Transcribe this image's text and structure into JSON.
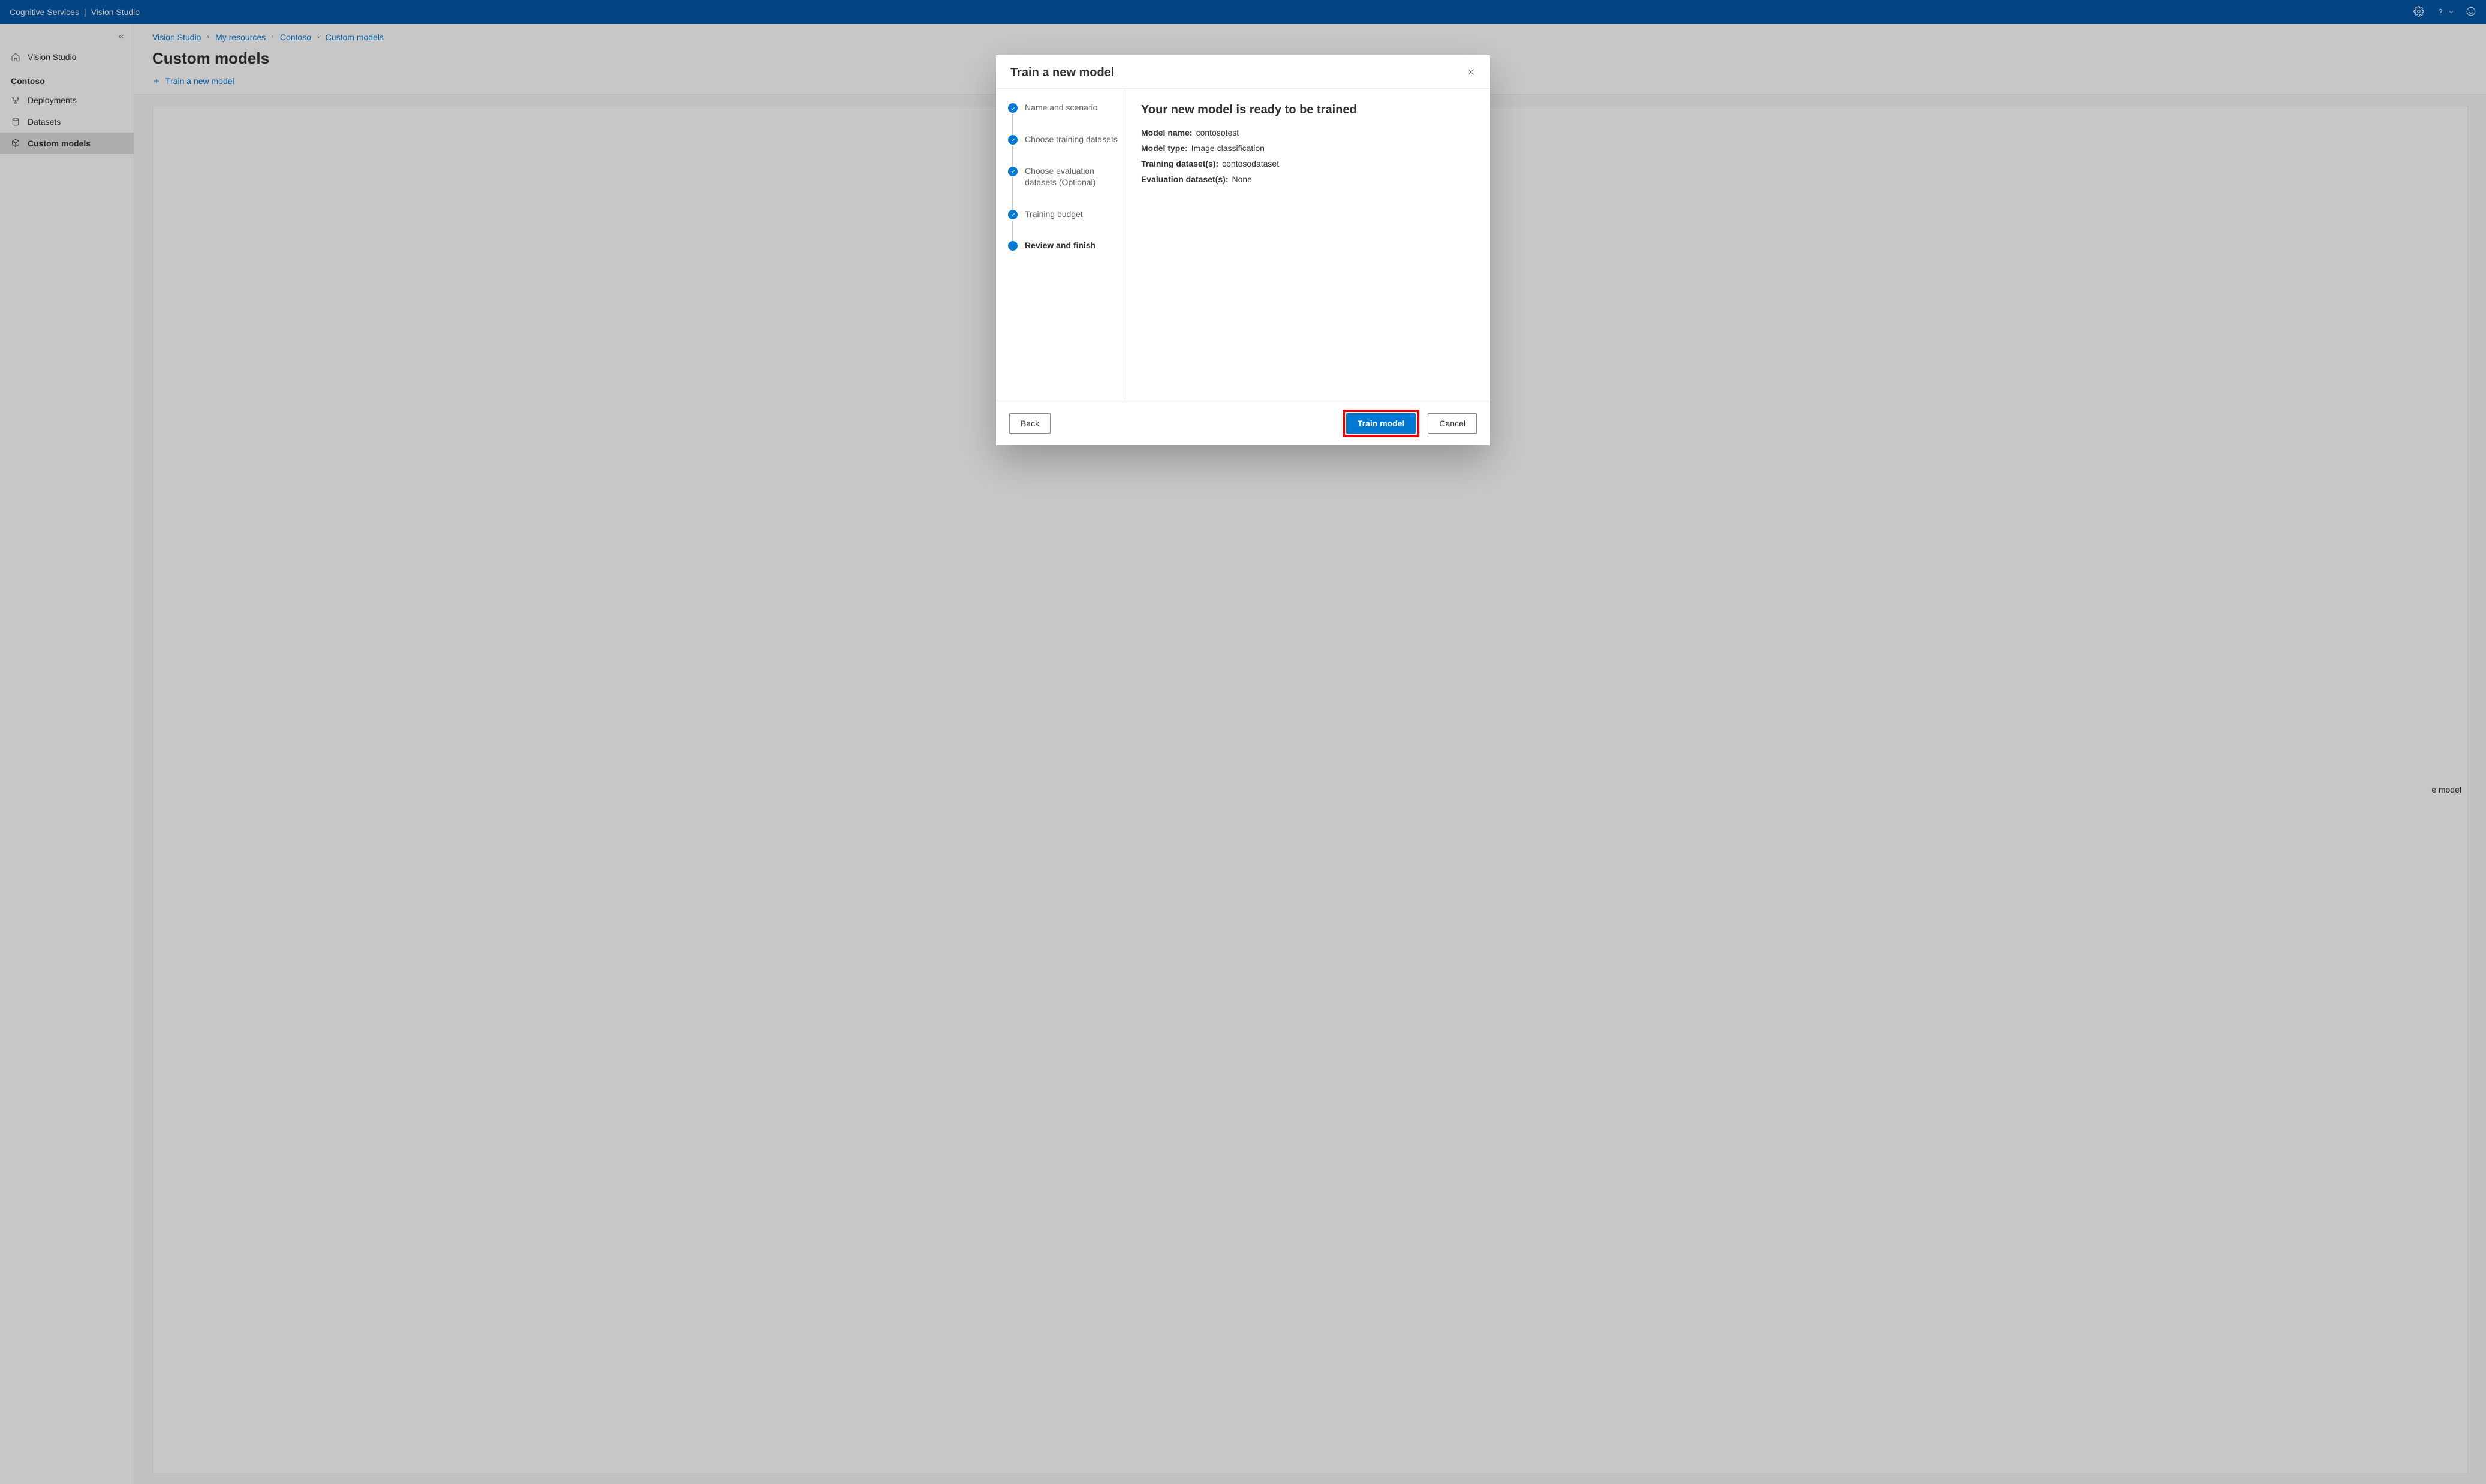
{
  "topbar": {
    "service": "Cognitive Services",
    "app": "Vision Studio"
  },
  "sidebar": {
    "home_label": "Vision Studio",
    "resource_label": "Contoso",
    "items": [
      {
        "label": "Deployments"
      },
      {
        "label": "Datasets"
      },
      {
        "label": "Custom models"
      }
    ]
  },
  "breadcrumbs": [
    "Vision Studio",
    "My resources",
    "Contoso",
    "Custom models"
  ],
  "page": {
    "title": "Custom models",
    "train_action": "Train a new model",
    "hint_right": "e model"
  },
  "dialog": {
    "title": "Train a new model",
    "steps": [
      {
        "label": "Name and scenario",
        "state": "done"
      },
      {
        "label": "Choose training datasets",
        "state": "done"
      },
      {
        "label": "Choose evaluation datasets (Optional)",
        "state": "done"
      },
      {
        "label": "Training budget",
        "state": "done"
      },
      {
        "label": "Review and finish",
        "state": "current"
      }
    ],
    "summary": {
      "heading": "Your new model is ready to be trained",
      "rows": [
        {
          "k": "Model name:",
          "v": "contosotest"
        },
        {
          "k": "Model type:",
          "v": "Image classification"
        },
        {
          "k": "Training dataset(s):",
          "v": "contosodataset"
        },
        {
          "k": "Evaluation dataset(s):",
          "v": "None"
        }
      ]
    },
    "buttons": {
      "back": "Back",
      "train": "Train model",
      "cancel": "Cancel"
    }
  }
}
